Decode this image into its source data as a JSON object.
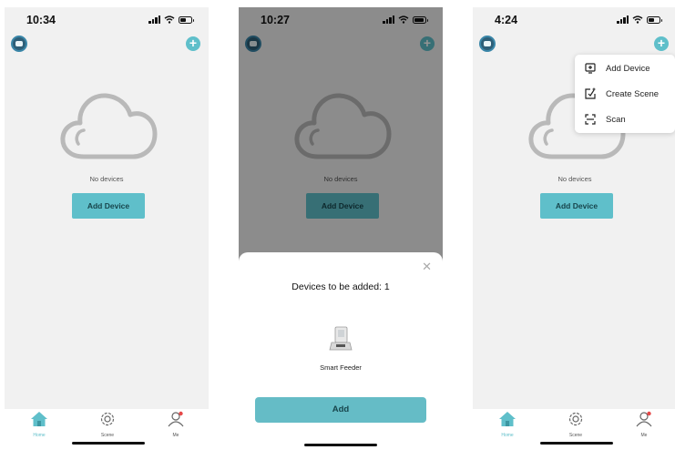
{
  "colors": {
    "accent": "#5fbfca",
    "background": "#f1f1f1",
    "overlay": "rgba(0,0,0,0.42)",
    "badge": "#e54848"
  },
  "screens": [
    {
      "status": {
        "time": "10:34"
      },
      "main": {
        "empty_text": "No devices",
        "add_device_label": "Add Device"
      },
      "tabs": [
        {
          "label": "Home",
          "icon": "home-icon"
        },
        {
          "label": "Scene",
          "icon": "gear-icon"
        },
        {
          "label": "Me",
          "icon": "person-icon"
        }
      ]
    },
    {
      "status": {
        "time": "10:27"
      },
      "main": {
        "empty_text": "No devices",
        "add_device_label": "Add Device"
      },
      "sheet": {
        "title": "Devices to be added: 1",
        "device_name": "Smart Feeder",
        "add_label": "Add"
      }
    },
    {
      "status": {
        "time": "4:24"
      },
      "main": {
        "empty_text": "No devices",
        "add_device_label": "Add Device"
      },
      "menu": {
        "items": [
          {
            "label": "Add Device",
            "icon": "add-device-icon"
          },
          {
            "label": "Create Scene",
            "icon": "create-scene-icon"
          },
          {
            "label": "Scan",
            "icon": "scan-icon"
          }
        ]
      },
      "tabs": [
        {
          "label": "Home",
          "icon": "home-icon"
        },
        {
          "label": "Scene",
          "icon": "gear-icon"
        },
        {
          "label": "Me",
          "icon": "person-icon"
        }
      ]
    }
  ]
}
